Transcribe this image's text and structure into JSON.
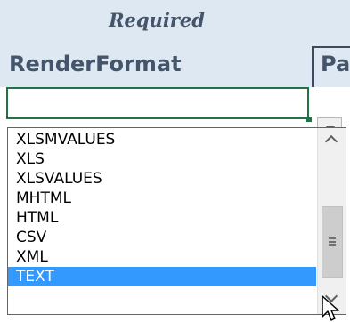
{
  "header": {
    "required_label": "Required",
    "column_title": "RenderFormat",
    "next_column_partial": "Pa"
  },
  "cell": {
    "value": ""
  },
  "dropdown": {
    "items": [
      {
        "label": "XLSMVALUES"
      },
      {
        "label": "XLS"
      },
      {
        "label": "XLSVALUES"
      },
      {
        "label": "MHTML"
      },
      {
        "label": "HTML"
      },
      {
        "label": "CSV"
      },
      {
        "label": "XML"
      },
      {
        "label": "TEXT"
      }
    ],
    "selected_label": "TEXT"
  },
  "icons": {
    "dropdown_arrow": "chevron-down-icon",
    "scroll_up": "chevron-up-icon",
    "scroll_down": "chevron-down-icon",
    "cursor": "mouse-pointer-icon"
  },
  "colors": {
    "header_background": "#dde8f3",
    "header_text": "#44546a",
    "selection_highlight": "#3399ff",
    "cell_border": "#217346"
  }
}
